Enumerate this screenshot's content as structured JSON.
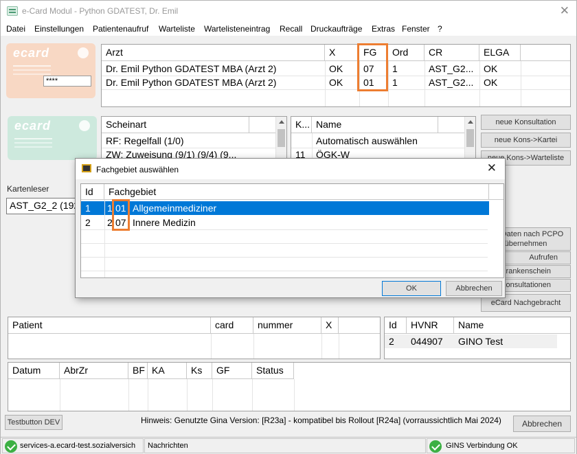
{
  "window": {
    "title": "e-Card Modul - Python GDATEST, Dr. Emil",
    "close_glyph": "✕"
  },
  "menu": [
    "Datei",
    "Einstellungen",
    "Patientenaufruf",
    "Warteliste",
    "Wartelisteneintrag",
    "Recall",
    "Druckaufträge",
    "Extras",
    "Fenster",
    "?"
  ],
  "card": {
    "logo_text": "ecard",
    "pin_value": "****"
  },
  "arzt_table": {
    "headers": [
      "Arzt",
      "X",
      "FG",
      "Ord",
      "CR",
      "ELGA"
    ],
    "rows": [
      [
        "Dr. Emil Python GDATEST MBA (Arzt 2)",
        "OK",
        "07",
        "1",
        "AST_G2...",
        "OK"
      ],
      [
        "Dr. Emil Python GDATEST MBA (Arzt 2)",
        "OK",
        "01",
        "1",
        "AST_G2...",
        "OK"
      ]
    ]
  },
  "schein_table": {
    "headers": [
      "Scheinart"
    ],
    "rows": [
      "RF: Regelfall (1/0)",
      "ZW: Zuweisung (9/1) (9/4) (9..."
    ]
  },
  "kasse_table": {
    "headers": [
      "K...",
      "Name"
    ],
    "rows": [
      [
        "",
        "Automatisch auswählen"
      ],
      [
        "11",
        "ÖGK-W"
      ]
    ]
  },
  "right_buttons": {
    "neue_konsultation": "neue Konsultation",
    "neue_kons_kartei": "neue Kons->Kartei",
    "neue_kons_warteliste": "neue Kons->Warteliste",
    "pcpo_line1": "...n-Daten nach PCPO",
    "pcpo_line2": "übernehmen",
    "aufrufen": "Aufrufen",
    "krankenschein": "Krankenschein",
    "konsultationen": "Konsultationen",
    "ecard_nachgebracht": "eCard Nachgebracht"
  },
  "kartenleser": {
    "label": "Kartenleser",
    "value": "AST_G2_2 (192"
  },
  "patient_table": {
    "headers": [
      "Patient",
      "card",
      "nummer",
      "X"
    ]
  },
  "hvnr_table": {
    "headers": [
      "Id",
      "HVNR",
      "Name"
    ],
    "rows": [
      [
        "2",
        "044907",
        "GINO Test"
      ]
    ]
  },
  "kons_table": {
    "headers": [
      "Datum",
      "AbrZr",
      "BF",
      "KA",
      "Ks",
      "GF",
      "Status"
    ]
  },
  "bottom": {
    "testbutton": "Testbutton DEV",
    "hint": "Hinweis: Genutzte Gina Version: [R23a] - kompatibel bis Rollout [R24a] (vorraussichtlich Mai 2024)",
    "abbrechen": "Abbrechen"
  },
  "statusbar": {
    "service": "services-a.ecard-test.sozialversich",
    "nachrichten": "Nachrichten",
    "gins": "GINS Verbindung OK"
  },
  "dialog": {
    "title": "Fachgebiet auswählen",
    "close_glyph": "✕",
    "headers": [
      "Id",
      "Fachgebiet"
    ],
    "rows": [
      {
        "id": "1",
        "num": "1",
        "code": "01",
        "name": "Allgemeinmediziner",
        "selected": true
      },
      {
        "id": "2",
        "num": "2",
        "code": "07",
        "name": "Innere Medizin",
        "selected": false
      }
    ],
    "ok": "OK",
    "cancel": "Abbrechen"
  },
  "colors": {
    "highlight": "#ed7d31",
    "selection": "#0078d7",
    "status_ok": "#3cb043"
  }
}
